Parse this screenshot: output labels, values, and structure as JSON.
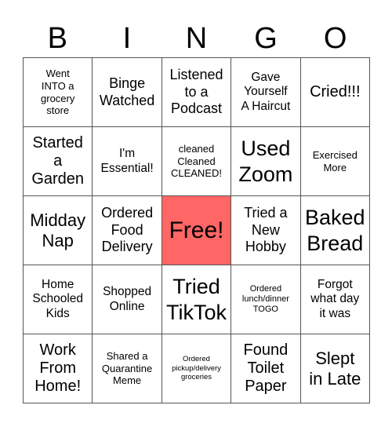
{
  "header": [
    "B",
    "I",
    "N",
    "G",
    "O"
  ],
  "free_color": "#ff6666",
  "cells": [
    [
      "Went\nINTO a\ngrocery\nstore",
      "Binge\nWatched",
      "Listened\nto a\nPodcast",
      "Gave\nYourself\nA Haircut",
      "Cried!!!"
    ],
    [
      "Started\na\nGarden",
      "I'm\nEssential!",
      "cleaned\nCleaned\nCLEANED!",
      "Used\nZoom",
      "Exercised\nMore"
    ],
    [
      "Midday\nNap",
      "Ordered\nFood\nDelivery",
      "Free!",
      "Tried a\nNew\nHobby",
      "Baked\nBread"
    ],
    [
      "Home\nSchooled\nKids",
      "Shopped\nOnline",
      "Tried\nTikTok",
      "Ordered\nlunch/dinner\nTOGO",
      "Forgot\nwhat day\nit was"
    ],
    [
      "Work\nFrom\nHome!",
      "Shared a\nQuarantine\nMeme",
      "Ordered\npickup/delivery\ngroceries",
      "Found\nToilet\nPaper",
      "Slept\nin Late"
    ]
  ]
}
